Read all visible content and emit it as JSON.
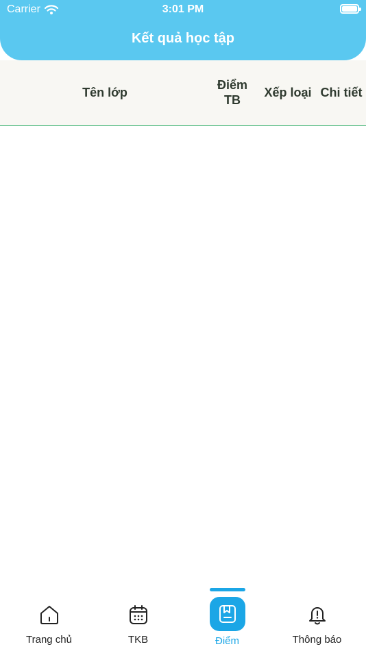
{
  "status_bar": {
    "carrier": "Carrier",
    "time": "3:01 PM"
  },
  "header": {
    "title": "Kết quả học tập"
  },
  "table": {
    "columns": [
      "Tên lớp",
      "Điểm TB",
      "Xếp loại",
      "Chi tiết"
    ],
    "rows": []
  },
  "tabbar": {
    "active_index": 2,
    "tabs": [
      {
        "label": "Trang chủ",
        "icon": "home-icon"
      },
      {
        "label": "TKB",
        "icon": "calendar-icon"
      },
      {
        "label": "Điểm",
        "icon": "gradebook-icon"
      },
      {
        "label": "Thông báo",
        "icon": "bell-icon"
      }
    ]
  },
  "colors": {
    "header_bg": "#5ac8f0",
    "accent": "#1ba6e6",
    "table_header_bg": "#f8f7f3",
    "divider": "#3cb371",
    "header_text": "#2f3a2f"
  }
}
